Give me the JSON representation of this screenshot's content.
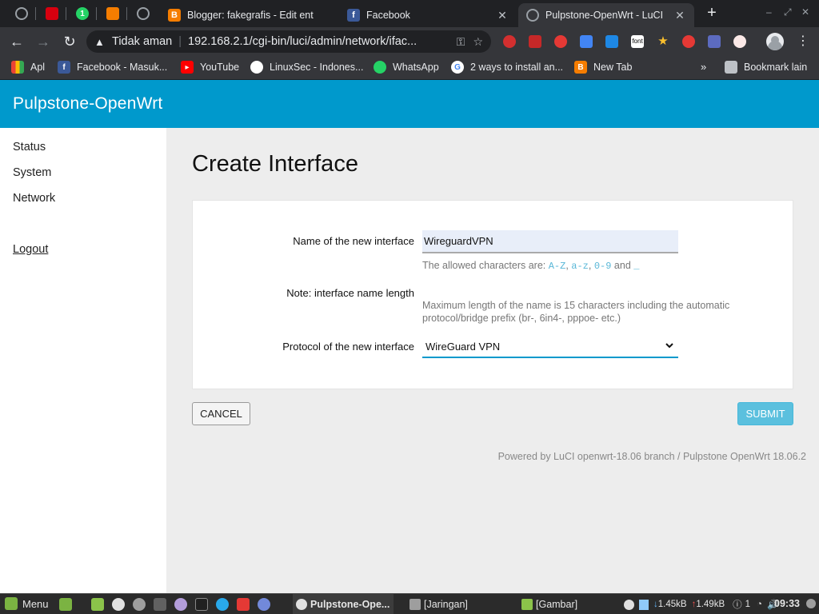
{
  "browser": {
    "tabs": [
      {
        "title": "Blogger: fakegrafis - Edit ent"
      },
      {
        "title": "Facebook"
      },
      {
        "title": "Pulpstone-OpenWrt - LuCI"
      }
    ],
    "pinned_tab_badge": "1",
    "security_label": "Tidak aman",
    "url": "192.168.2.1/cgi-bin/luci/admin/network/ifac...",
    "extension_label": "font",
    "bookmarks": [
      {
        "label": "Apl"
      },
      {
        "label": "Facebook - Masuk..."
      },
      {
        "label": "YouTube"
      },
      {
        "label": "LinuxSec - Indones..."
      },
      {
        "label": "WhatsApp"
      },
      {
        "label": "2 ways to install an..."
      },
      {
        "label": "New Tab"
      }
    ],
    "more_bookmarks": "»",
    "other_bookmarks": "Bookmark lain"
  },
  "app": {
    "brand": "Pulpstone-OpenWrt",
    "nav": [
      "Status",
      "System",
      "Network"
    ],
    "logout": "Logout"
  },
  "page": {
    "title": "Create Interface",
    "name_label": "Name of the new interface",
    "name_value": "WireguardVPN",
    "allowed_prefix": "The allowed characters are: ",
    "allowed_az_upper": "A-Z",
    "allowed_sep1": ", ",
    "allowed_az_lower": "a-z",
    "allowed_sep2": ", ",
    "allowed_09": "0-9",
    "allowed_and": " and ",
    "allowed_underscore": "_",
    "note_label": "Note: interface name length",
    "note_hint": "Maximum length of the name is 15 characters including the automatic protocol/bridge prefix (br-, 6in4-, pppoe- etc.)",
    "protocol_label": "Protocol of the new interface",
    "protocol_value": "WireGuard VPN",
    "cancel": "CANCEL",
    "submit": "SUBMIT",
    "footer": "Powered by LuCI openwrt-18.06 branch / Pulpstone OpenWrt 18.06.2"
  },
  "taskbar": {
    "menu": "Menu",
    "windows": [
      {
        "title": "Pulpstone-Ope..."
      },
      {
        "title": "[Jaringan]"
      },
      {
        "title": "[Gambar]"
      }
    ],
    "net_down": "1.45kB",
    "net_up": "1.49kB",
    "notif": "1",
    "time": "09:33"
  },
  "colors": {
    "luci_header": "#0099cc",
    "submit": "#5bc0de",
    "allowed_code": "#59b7d7"
  }
}
